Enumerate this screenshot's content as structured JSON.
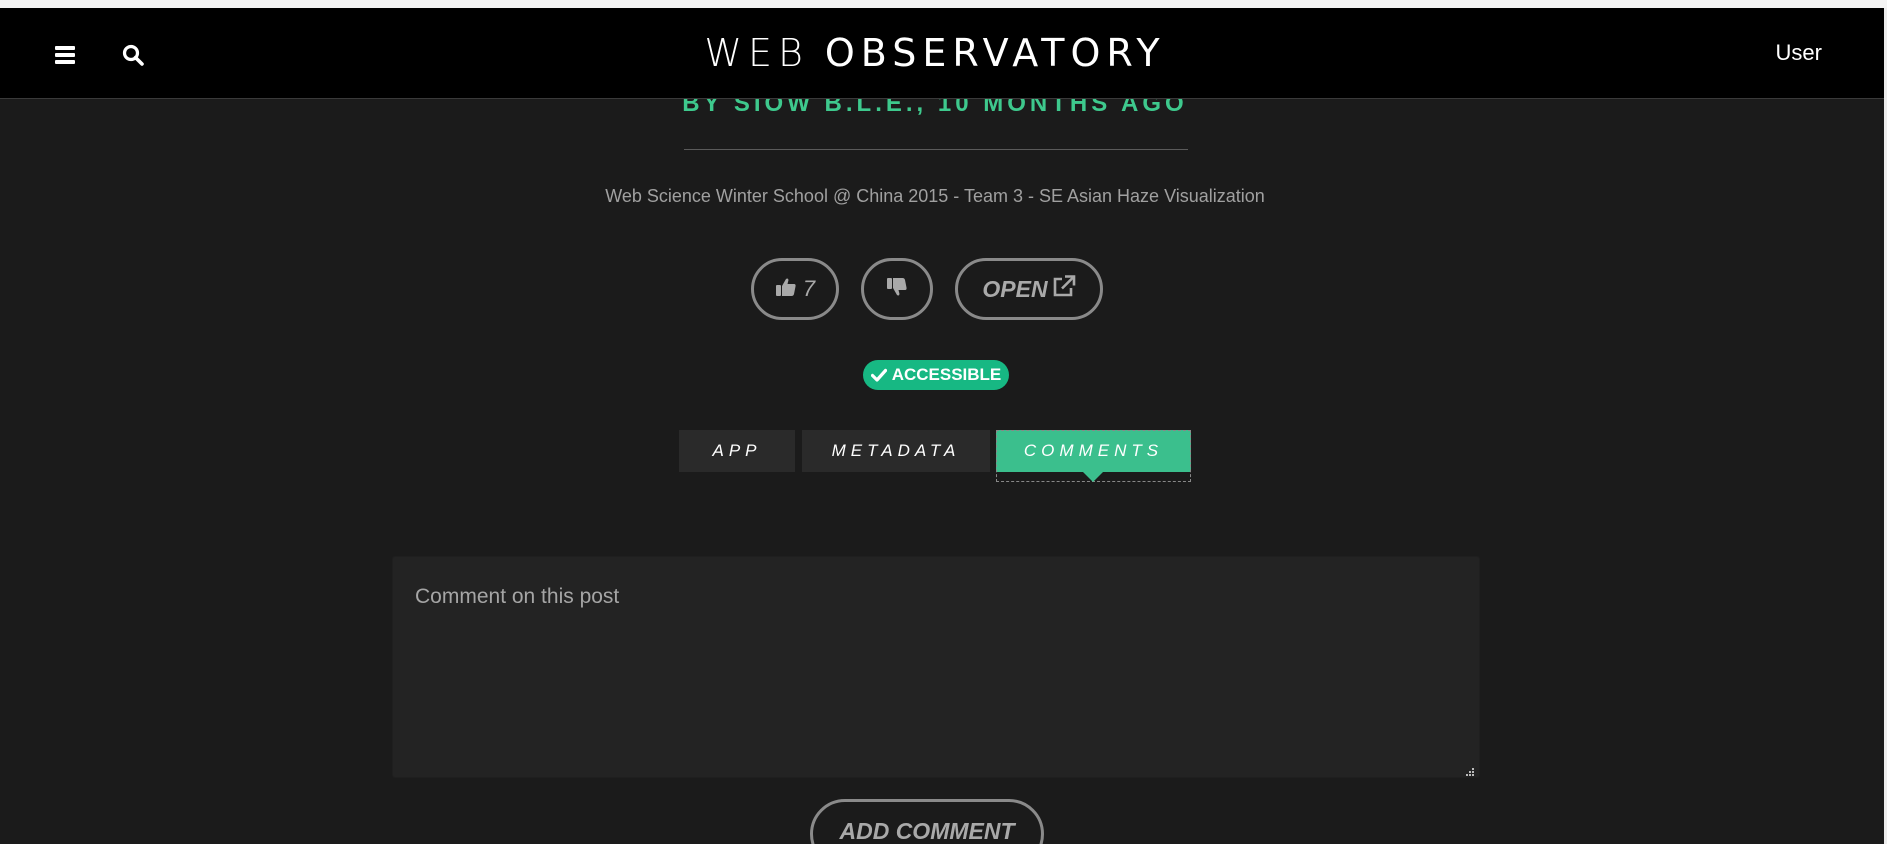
{
  "navbar": {
    "brand_part1": "WEB",
    "brand_part2": "OBSERVATORY",
    "user_label": "User",
    "icons": [
      "menu-icon",
      "search-icon"
    ]
  },
  "post": {
    "byline": "BY SIOW B.L.E., 10 MONTHS AGO",
    "title": "Web Science Winter School @ China 2015 - Team 3 - SE Asian Haze Visualization",
    "like_count": "7",
    "open_label": "OPEN",
    "badge_label": "ACCESSIBLE"
  },
  "tabs": [
    {
      "label": "APP"
    },
    {
      "label": "METADATA"
    },
    {
      "label": "COMMENTS",
      "active": true
    }
  ],
  "comments": {
    "placeholder": "Comment on this post",
    "submit_label": "ADD COMMENT"
  },
  "colors": {
    "accent": "#3ec98d",
    "badge": "#17b883",
    "active_tab": "#3bbf8d",
    "background": "#1b1b1b",
    "navbar": "#000000"
  }
}
